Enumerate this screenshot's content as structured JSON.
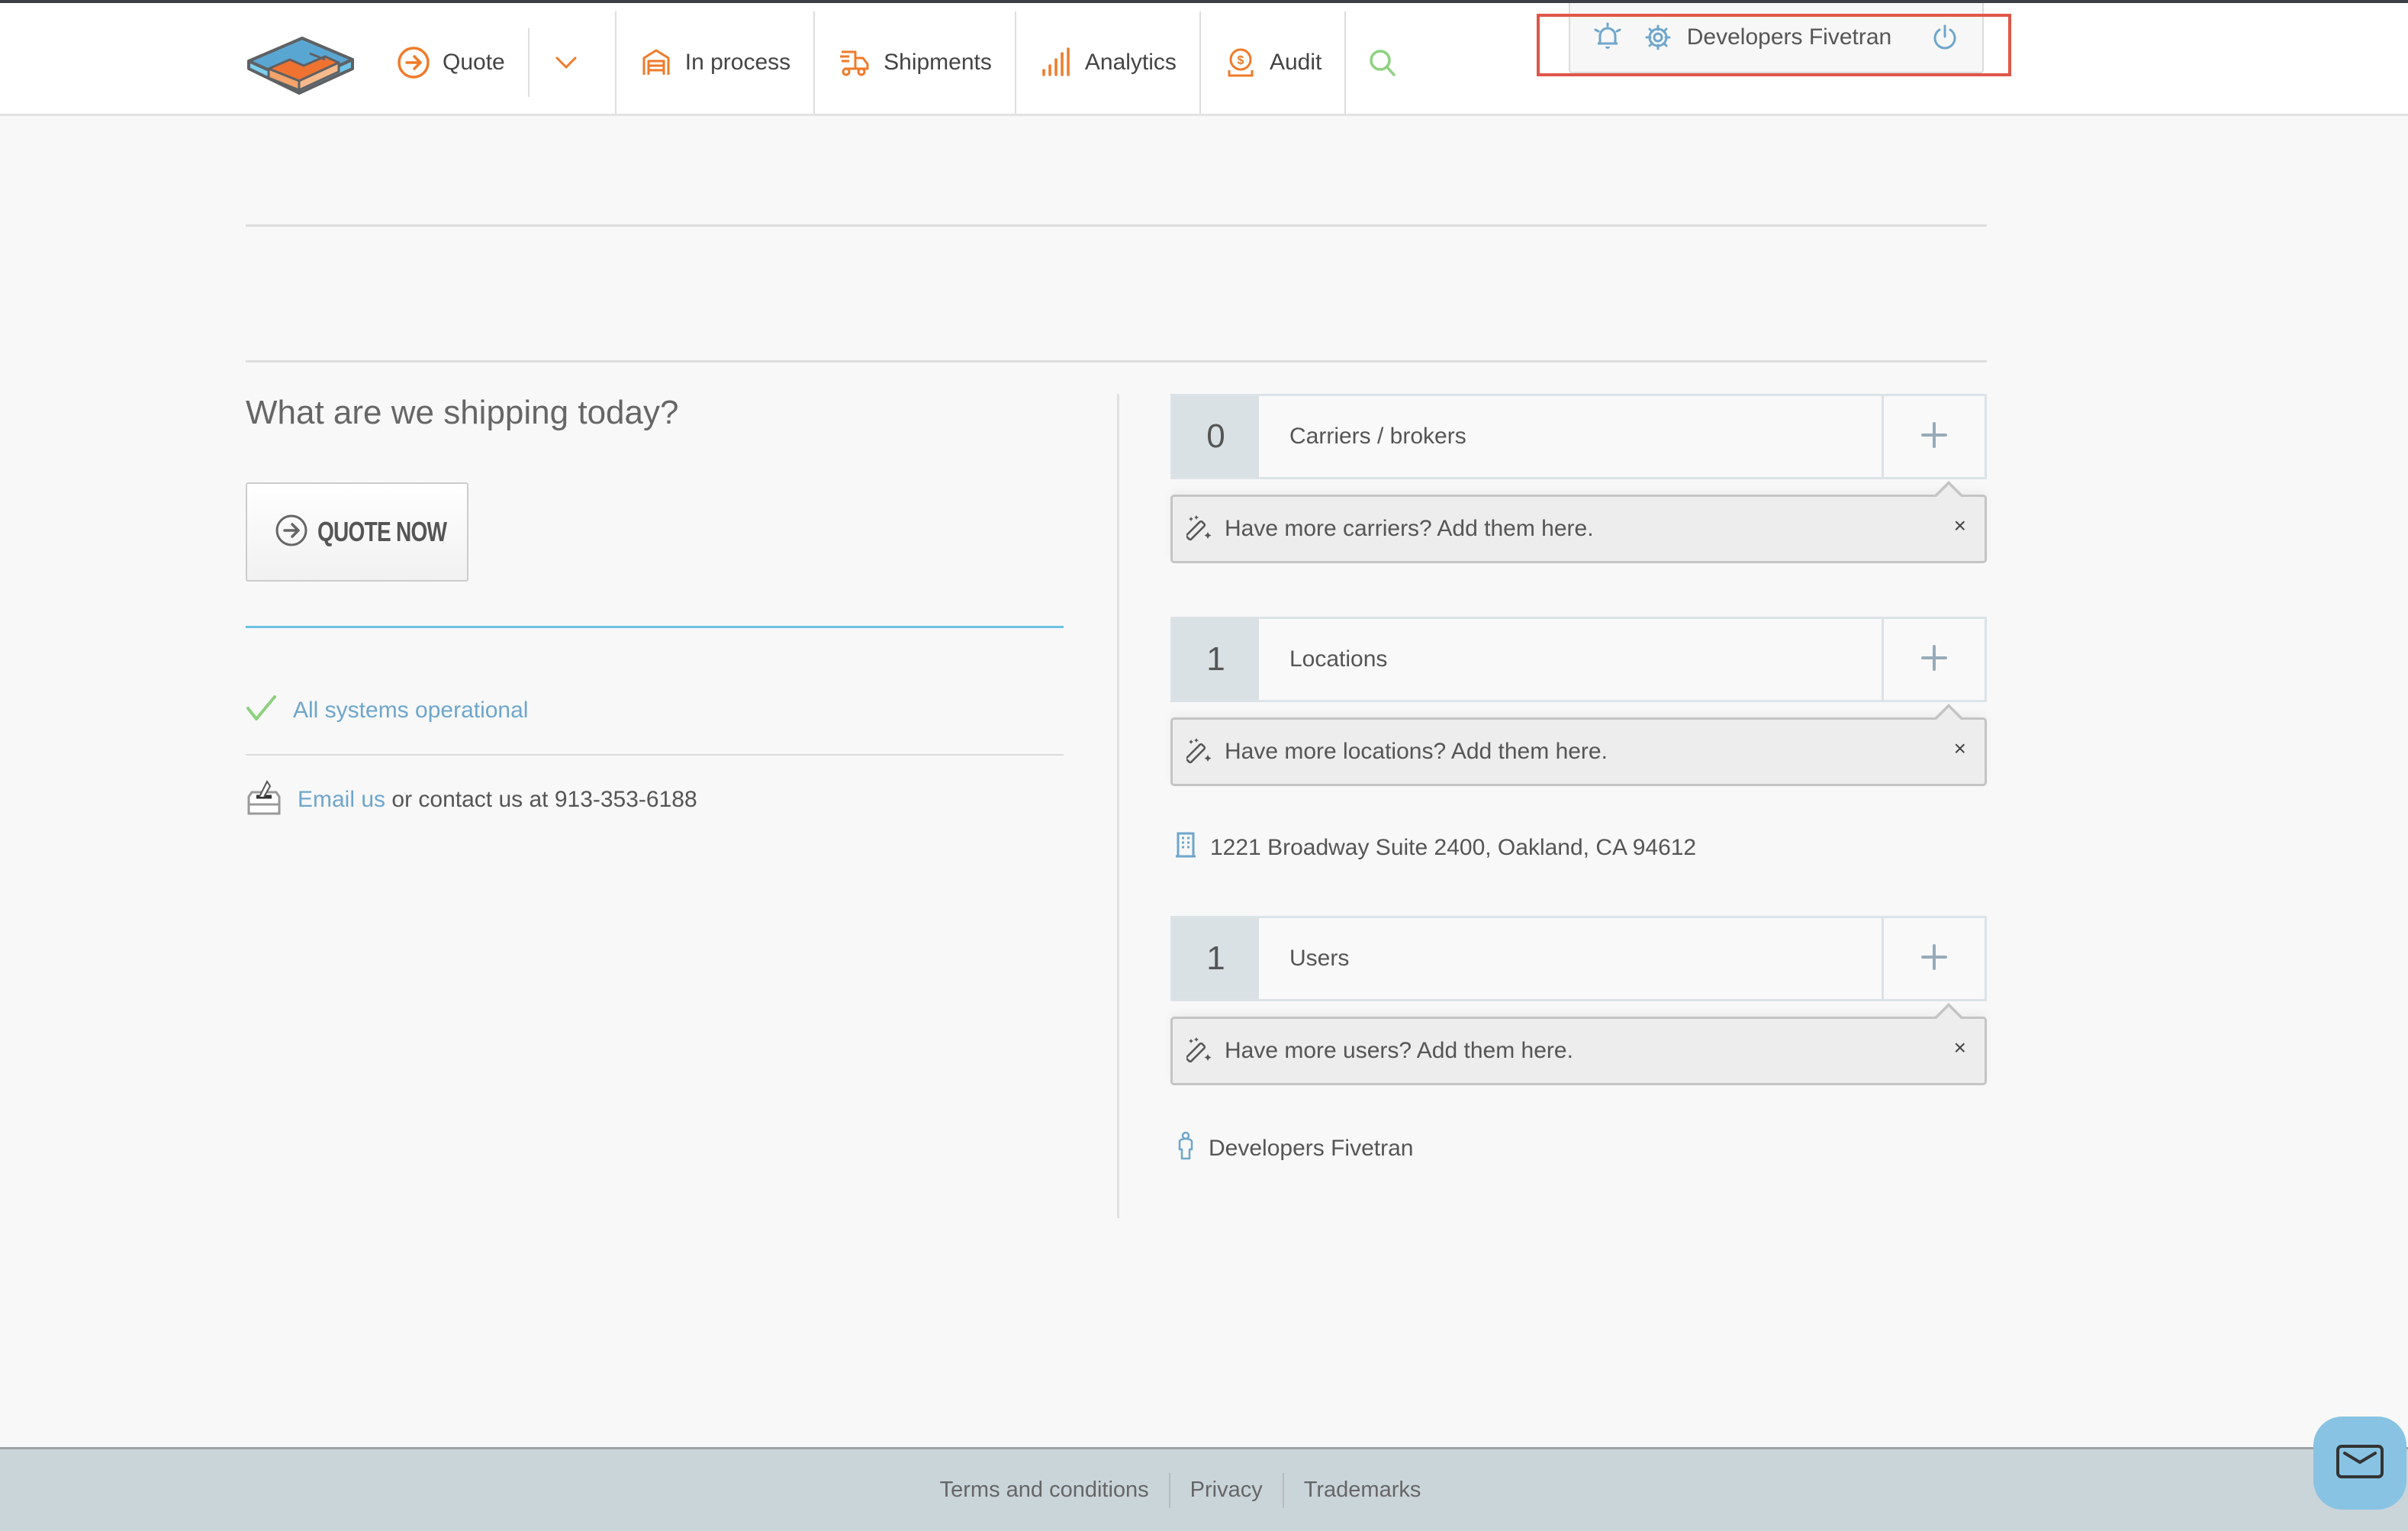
{
  "header": {
    "logo_alt": "Company logo",
    "nav": [
      {
        "id": "quote",
        "label": "Quote",
        "icon": "arrow-circle-right-icon"
      },
      {
        "id": "in-process",
        "label": "In process",
        "icon": "garage-icon"
      },
      {
        "id": "shipments",
        "label": "Shipments",
        "icon": "delivery-truck-icon"
      },
      {
        "id": "analytics",
        "label": "Analytics",
        "icon": "bar-signal-icon"
      },
      {
        "id": "audit",
        "label": "Audit",
        "icon": "dollar-coin-icon"
      }
    ],
    "search_icon": "search-icon",
    "dropdown_icon": "chevron-down-icon",
    "user_panel": {
      "notifications_icon": "bell-icon",
      "settings_icon": "gear-icon",
      "user_name": "Developers Fivetran",
      "logout_icon": "power-icon"
    }
  },
  "main": {
    "left": {
      "headline": "What are we shipping today?",
      "quote_button": "QUOTE NOW",
      "status": "All systems operational",
      "contact": {
        "email_link": "Email us",
        "text": " or contact us at 913-353-6188"
      }
    },
    "right": {
      "cards": [
        {
          "count": "0",
          "label": "Carriers / brokers",
          "tip": "Have more carriers? Add them here."
        },
        {
          "count": "1",
          "label": "Locations",
          "tip": "Have more locations? Add them here."
        },
        {
          "count": "1",
          "label": "Users",
          "tip": "Have more users? Add them here."
        }
      ],
      "location_address": "1221 Broadway Suite 2400, Oakland, CA 94612",
      "user_entry": "Developers Fivetran",
      "add_symbol": "+",
      "close_symbol": "×"
    }
  },
  "footer": {
    "links": [
      "Terms and conditions",
      "Privacy",
      "Trademarks"
    ]
  },
  "colors": {
    "accent_orange": "#ef7b2a",
    "link_blue": "#6ea6cc",
    "status_green": "#8dd17f",
    "highlight_red": "#e0564a",
    "footer_bg": "#cad5da",
    "chat_blue": "#88c3e3"
  }
}
